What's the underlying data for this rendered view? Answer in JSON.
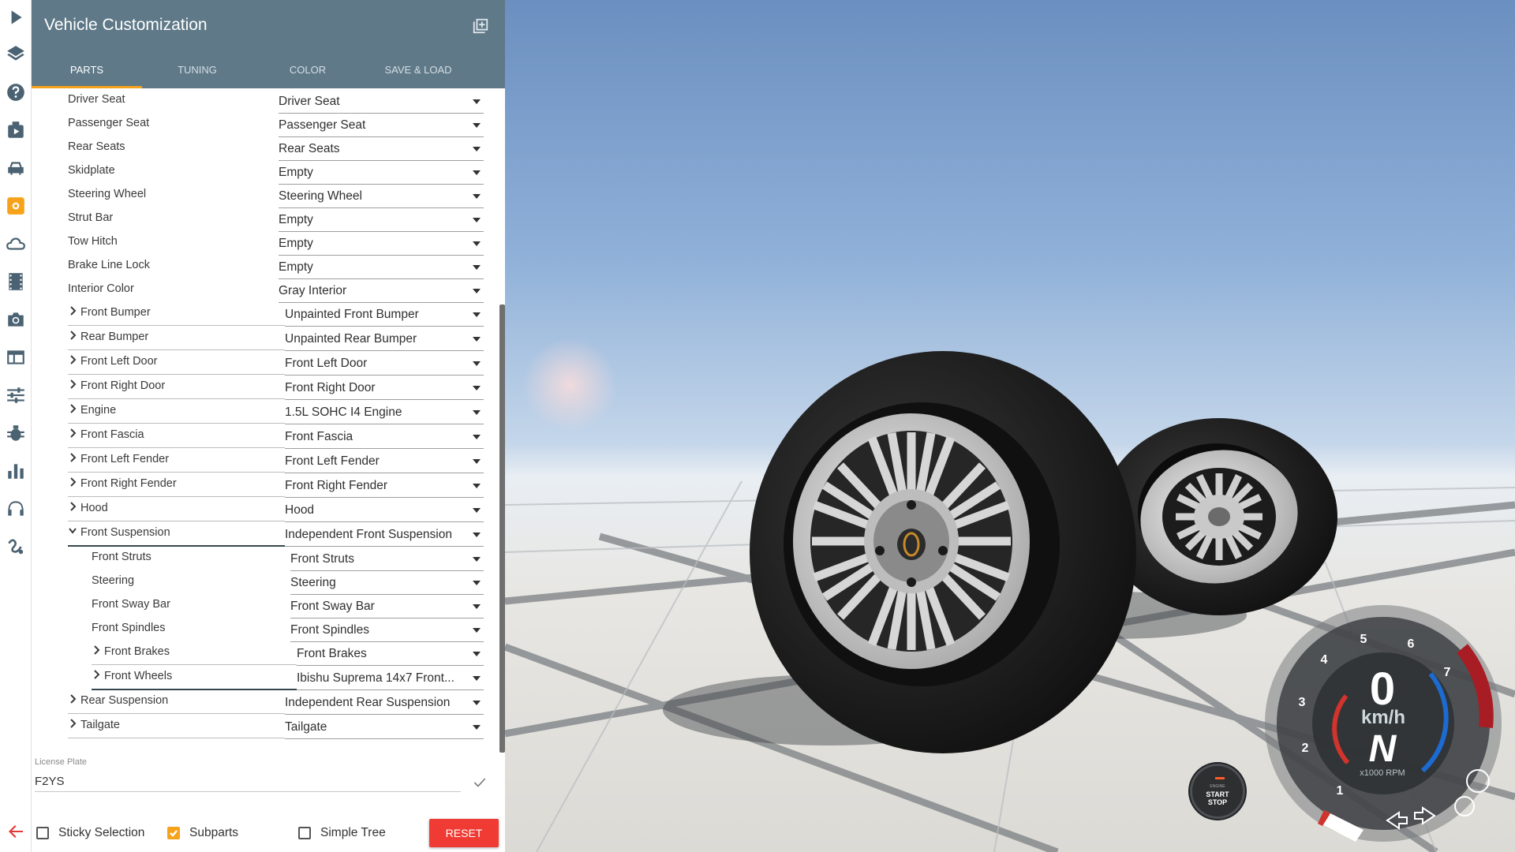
{
  "panel": {
    "title": "Vehicle Customization",
    "tabs": [
      "PARTS",
      "TUNING",
      "COLOR",
      "SAVE & LOAD"
    ],
    "active_tab": 0,
    "accent_color": "#f7a21b",
    "header_color": "#5f7988"
  },
  "parts": [
    {
      "label": "Driver Seat",
      "value": "Driver Seat"
    },
    {
      "label": "Passenger Seat",
      "value": "Passenger Seat"
    },
    {
      "label": "Rear Seats",
      "value": "Rear Seats"
    },
    {
      "label": "Skidplate",
      "value": "Empty"
    },
    {
      "label": "Steering Wheel",
      "value": "Steering Wheel"
    },
    {
      "label": "Strut Bar",
      "value": "Empty"
    },
    {
      "label": "Tow Hitch",
      "value": "Empty"
    },
    {
      "label": "Brake Line Lock",
      "value": "Empty"
    },
    {
      "label": "Interior Color",
      "value": "Gray Interior"
    },
    {
      "label": "Front Bumper",
      "value": "Unpainted Front Bumper"
    },
    {
      "label": "Rear Bumper",
      "value": "Unpainted Rear Bumper"
    },
    {
      "label": "Front Left Door",
      "value": "Front Left Door"
    },
    {
      "label": "Front Right Door",
      "value": "Front Right Door"
    },
    {
      "label": "Engine",
      "value": "1.5L SOHC I4 Engine"
    },
    {
      "label": "Front Fascia",
      "value": "Front Fascia"
    },
    {
      "label": "Front Left Fender",
      "value": "Front Left Fender"
    },
    {
      "label": "Front Right Fender",
      "value": "Front Right Fender"
    },
    {
      "label": "Hood",
      "value": "Hood"
    },
    {
      "label": "Front Suspension",
      "value": "Independent Front Suspension"
    },
    {
      "label": "Front Struts",
      "value": "Front Struts"
    },
    {
      "label": "Steering",
      "value": "Steering"
    },
    {
      "label": "Front Sway Bar",
      "value": "Front Sway Bar"
    },
    {
      "label": "Front Spindles",
      "value": "Front Spindles"
    },
    {
      "label": "Front Brakes",
      "value": "Front Brakes"
    },
    {
      "label": "Front Wheels",
      "value": "Ibishu Suprema 14x7 Front..."
    },
    {
      "label": "Rear Suspension",
      "value": "Independent Rear Suspension"
    },
    {
      "label": "Tailgate",
      "value": "Tailgate"
    }
  ],
  "license": {
    "label": "License Plate",
    "value": "F2YS"
  },
  "options": {
    "sticky_selection": {
      "label": "Sticky Selection",
      "checked": false
    },
    "subparts": {
      "label": "Subparts",
      "checked": true
    },
    "simple_tree": {
      "label": "Simple Tree",
      "checked": false
    }
  },
  "reset_label": "RESET",
  "hud": {
    "speed": "0",
    "unit": "km/h",
    "gear": "N",
    "rpm_label": "x1000 RPM",
    "rpm_ticks": [
      "1",
      "2",
      "3",
      "4",
      "5",
      "6",
      "7"
    ],
    "start_stop": {
      "line1": "ENGINE",
      "line2": "START",
      "line3": "STOP"
    }
  }
}
